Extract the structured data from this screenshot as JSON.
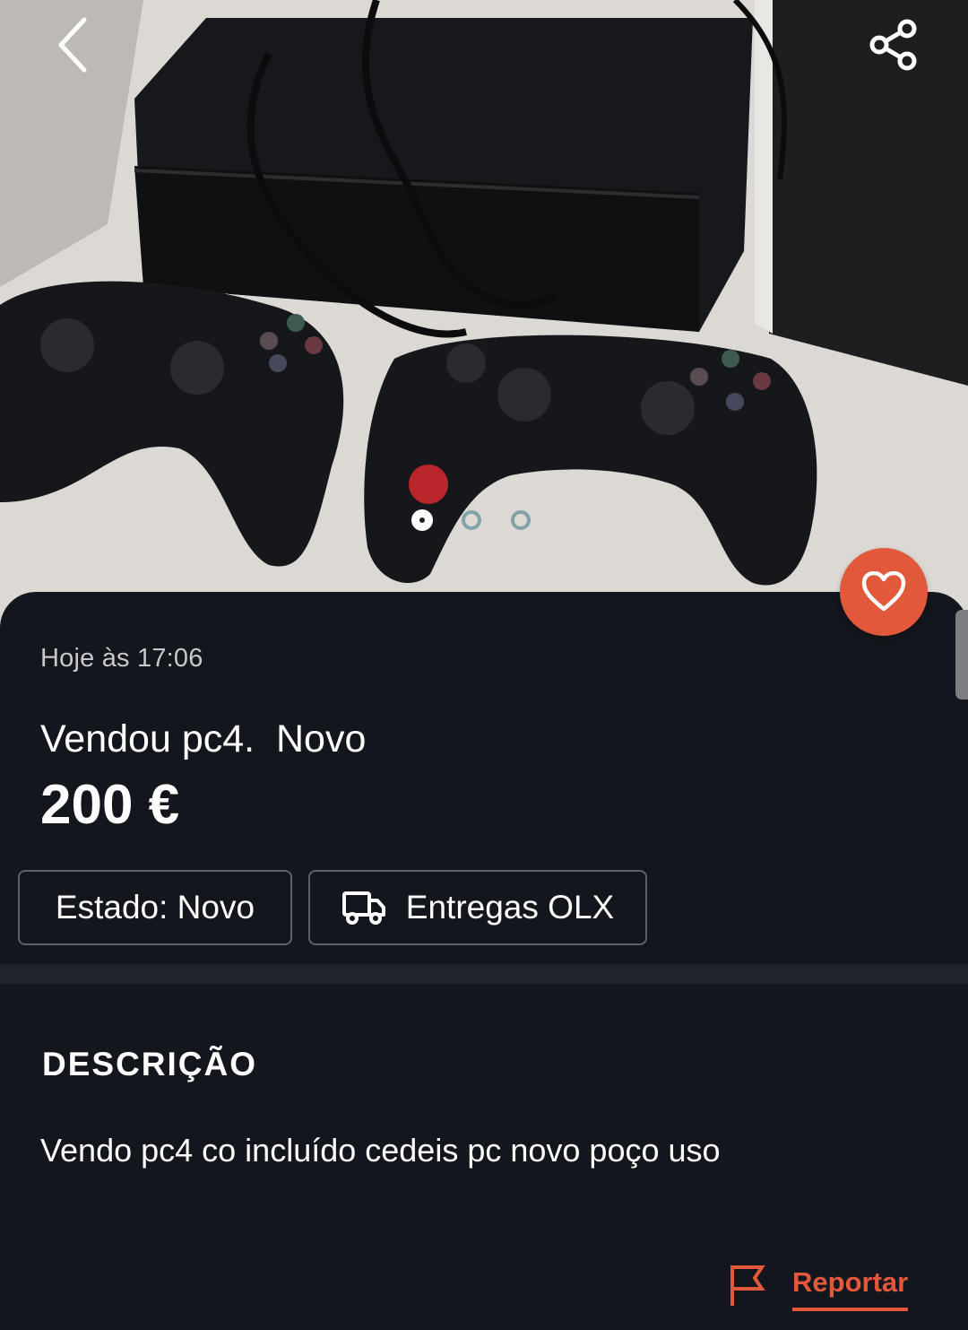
{
  "ad": {
    "date": "Hoje às 17:06",
    "title": "Vendou pc4.  Novo",
    "price": "200 €"
  },
  "gallery": {
    "image_count": 3,
    "active_index": 0
  },
  "chips": {
    "state": "Estado: Novo",
    "delivery": "Entregas OLX"
  },
  "description": {
    "heading": "DESCRIÇÃO",
    "text": "Vendo pc4 co incluído cedeis pc novo poço uso"
  },
  "actions": {
    "report": "Reportar"
  },
  "icons": {
    "back": "chevron-left-icon",
    "share": "share-icon",
    "favorite": "heart-icon",
    "delivery": "truck-icon",
    "report": "flag-icon"
  },
  "colors": {
    "accent": "#e2583b",
    "background": "#13161c",
    "chip_border": "#5d6066",
    "inactive_dot": "#7fa3a8"
  }
}
